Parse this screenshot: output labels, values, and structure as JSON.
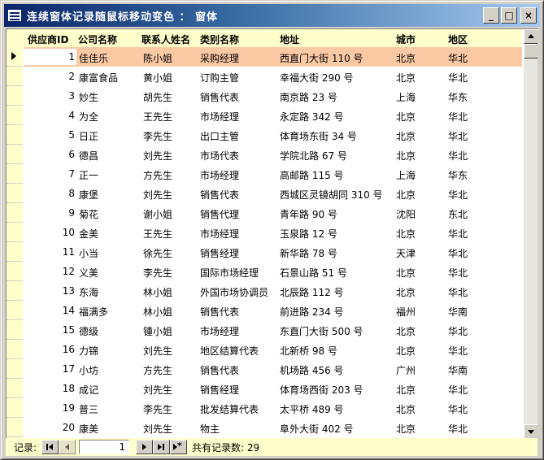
{
  "window": {
    "title": "连续窗体记录随鼠标移动变色 ： 窗体",
    "minimize_glyph": "_",
    "maximize_glyph": "□",
    "close_glyph": "×"
  },
  "columns": {
    "id": "供应商ID",
    "company": "公司名称",
    "contact": "联系人姓名",
    "title": "类别名称",
    "address": "地址",
    "city": "城市",
    "region": "地区"
  },
  "rows": [
    {
      "id": "1",
      "company": "佳佳乐",
      "contact": "陈小姐",
      "title": "采购经理",
      "address": "西直门大街 110 号",
      "city": "北京",
      "region": "华北"
    },
    {
      "id": "2",
      "company": "康富食品",
      "contact": "黄小姐",
      "title": "订购主管",
      "address": "幸福大街 290 号",
      "city": "北京",
      "region": "华北"
    },
    {
      "id": "3",
      "company": "妙生",
      "contact": "胡先生",
      "title": "销售代表",
      "address": "南京路 23 号",
      "city": "上海",
      "region": "华东"
    },
    {
      "id": "4",
      "company": "为全",
      "contact": "王先生",
      "title": "市场经理",
      "address": "永定路 342 号",
      "city": "北京",
      "region": "华北"
    },
    {
      "id": "5",
      "company": "日正",
      "contact": "李先生",
      "title": "出口主管",
      "address": "体育场东街 34 号",
      "city": "北京",
      "region": "华北"
    },
    {
      "id": "6",
      "company": "德昌",
      "contact": "刘先生",
      "title": "市场代表",
      "address": "学院北路 67 号",
      "city": "北京",
      "region": "华北"
    },
    {
      "id": "7",
      "company": "正一",
      "contact": "方先生",
      "title": "市场经理",
      "address": "高邮路 115 号",
      "city": "上海",
      "region": "华东"
    },
    {
      "id": "8",
      "company": "康堡",
      "contact": "刘先生",
      "title": "销售代表",
      "address": "西城区灵镜胡同 310 号",
      "city": "北京",
      "region": "华北"
    },
    {
      "id": "9",
      "company": "菊花",
      "contact": "谢小姐",
      "title": "销售代理",
      "address": "青年路 90 号",
      "city": "沈阳",
      "region": "东北"
    },
    {
      "id": "10",
      "company": "金美",
      "contact": "王先生",
      "title": "市场经理",
      "address": "玉泉路 12 号",
      "city": "北京",
      "region": "华北"
    },
    {
      "id": "11",
      "company": "小当",
      "contact": "徐先生",
      "title": "销售经理",
      "address": "新华路 78 号",
      "city": "天津",
      "region": "华北"
    },
    {
      "id": "12",
      "company": "义美",
      "contact": "李先生",
      "title": "国际市场经理",
      "address": "石景山路 51 号",
      "city": "北京",
      "region": "华北"
    },
    {
      "id": "13",
      "company": "东海",
      "contact": "林小姐",
      "title": "外国市场协调员",
      "address": "北辰路 112 号",
      "city": "北京",
      "region": "华北"
    },
    {
      "id": "14",
      "company": "福满多",
      "contact": "林小姐",
      "title": "销售代表",
      "address": "前进路 234 号",
      "city": "福州",
      "region": "华南"
    },
    {
      "id": "15",
      "company": "德级",
      "contact": "锺小姐",
      "title": "市场经理",
      "address": "东直门大街 500 号",
      "city": "北京",
      "region": "华北"
    },
    {
      "id": "16",
      "company": "力锦",
      "contact": "刘先生",
      "title": "地区结算代表",
      "address": "北新桥 98 号",
      "city": "北京",
      "region": "华北"
    },
    {
      "id": "17",
      "company": "小坊",
      "contact": "方先生",
      "title": "销售代表",
      "address": "机场路 456 号",
      "city": "广州",
      "region": "华南"
    },
    {
      "id": "18",
      "company": "成记",
      "contact": "刘先生",
      "title": "销售经理",
      "address": "体育场西街 203 号",
      "city": "北京",
      "region": "华北"
    },
    {
      "id": "19",
      "company": "普三",
      "contact": "李先生",
      "title": "批发结算代表",
      "address": "太平桥 489 号",
      "city": "北京",
      "region": "华北"
    },
    {
      "id": "20",
      "company": "康美",
      "contact": "刘先生",
      "title": "物主",
      "address": "阜外大街 402 号",
      "city": "北京",
      "region": "华北"
    }
  ],
  "active_row_index": 0,
  "navigation": {
    "label": "记录:",
    "current_record": "1",
    "total_text": "共有记录数: 29",
    "new_record_glyph": "*"
  },
  "colors": {
    "header_bg": "#ffffcc",
    "active_row_bg": "#fbc9a4",
    "titlebar_start": "#0a246a",
    "titlebar_end": "#a6caf0"
  }
}
